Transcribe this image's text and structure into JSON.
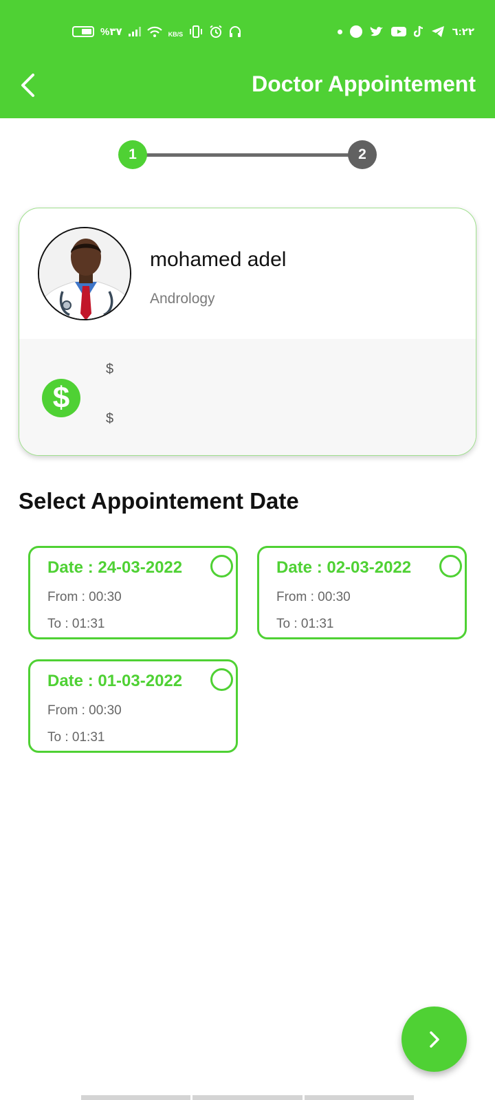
{
  "status_bar": {
    "battery_percent": "%٣٧",
    "speed_unit": "KB/S",
    "time": "٦:٢٢",
    "left_icons": [
      "battery-icon",
      "signal-icon",
      "wifi-icon",
      "vibrate-icon",
      "alarm-icon",
      "headset-icon"
    ],
    "right_icons": [
      "notification-dot-icon",
      "facebook-icon",
      "twitter-icon",
      "youtube-icon",
      "tiktok-icon",
      "telegram-icon"
    ]
  },
  "app_bar": {
    "title": "Doctor Appointement",
    "back_icon": "chevron-left-icon",
    "color": "#4fd134"
  },
  "stepper": {
    "current_step": 1,
    "steps": [
      {
        "label": "1",
        "state": "active"
      },
      {
        "label": "2",
        "state": "inactive"
      }
    ]
  },
  "doctor": {
    "name": "mohamed adel",
    "specialty": "Andrology",
    "avatar_icon": "doctor-avatar",
    "price_icon": "dollar-icon",
    "price_line_1": "$",
    "price_line_2": "$"
  },
  "appointments": {
    "title": "Select Appointement Date",
    "items": [
      {
        "date": "Date : 24-03-2022",
        "from": "From : 00:30",
        "to": "To : 01:31",
        "selected": false
      },
      {
        "date": "Date : 02-03-2022",
        "from": "From : 00:30",
        "to": "To : 01:31",
        "selected": false
      },
      {
        "date": "Date : 01-03-2022",
        "from": "From : 00:30",
        "to": "To : 01:31",
        "selected": false
      }
    ]
  },
  "next_button": {
    "icon": "chevron-right-icon"
  },
  "colors": {
    "primary": "#4fd134",
    "inactive_step": "#616161",
    "muted_text": "#7a7a7a"
  }
}
